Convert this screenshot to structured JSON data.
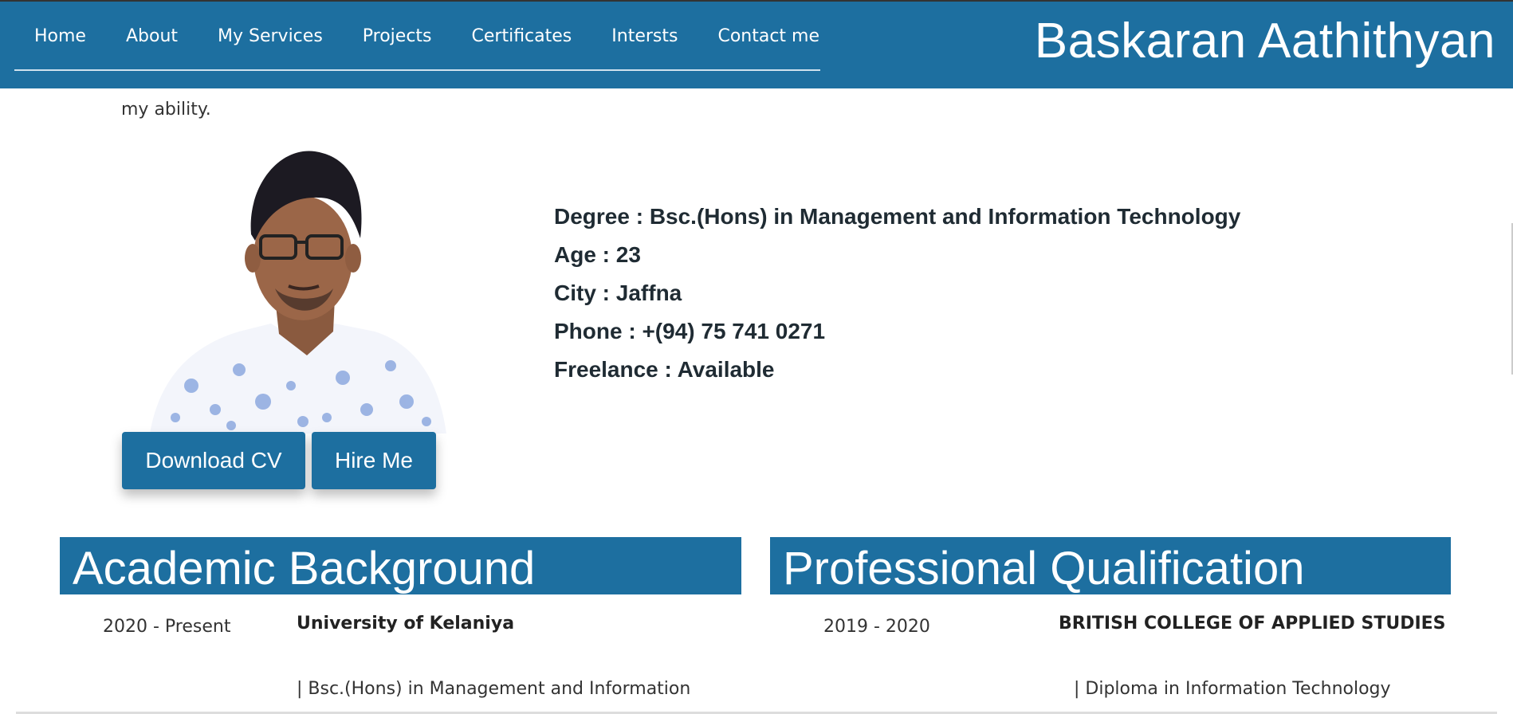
{
  "nav": {
    "items": [
      "Home",
      "About",
      "My Services",
      "Projects",
      "Certificates",
      "Intersts",
      "Contact me"
    ],
    "brand": "Baskaran Aathithyan"
  },
  "about": {
    "partial_text": "my ability."
  },
  "buttons": {
    "download_cv": "Download CV",
    "hire_me": "Hire Me"
  },
  "details": [
    "Degree : Bsc.(Hons) in Management and Information Technology",
    "Age : 23",
    "City : Jaffna",
    "Phone : +(94) 75 741 0271",
    "Freelance : Available"
  ],
  "academic": {
    "title": "Academic Background",
    "period": "2020 - Present",
    "institution": "University of Kelaniya",
    "course": "| Bsc.(Hons) in Management and Information"
  },
  "professional": {
    "title": "Professional Qualification",
    "period": "2019 - 2020",
    "institution": "BRITISH COLLEGE OF APPLIED STUDIES",
    "course": "| Diploma in Information Technology"
  },
  "colors": {
    "brand_blue": "#1d6fa0"
  }
}
